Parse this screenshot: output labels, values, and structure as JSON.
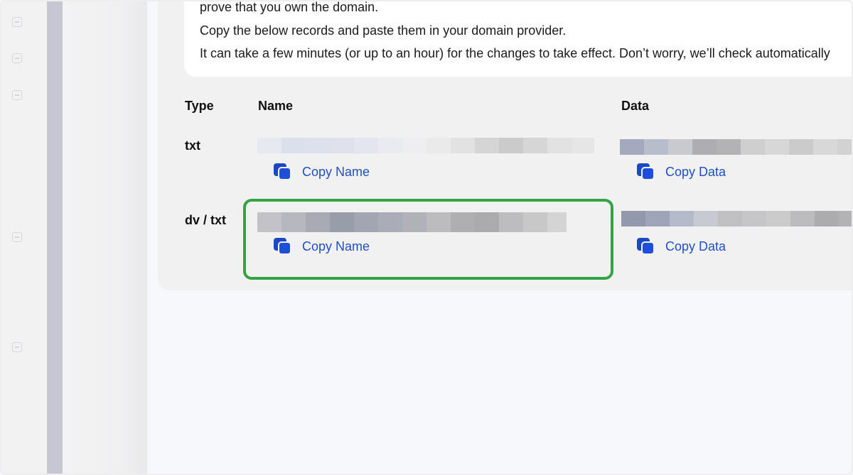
{
  "info": {
    "line1": "prove that you own the domain.",
    "line2": "Copy the below records and paste them in your domain provider.",
    "line3": "It can take a few minutes (or up to an hour) for the changes to take effect. Don’t worry, we’ll check automatically"
  },
  "table": {
    "headers": {
      "type": "Type",
      "name": "Name",
      "data": "Data"
    },
    "rows": [
      {
        "type": "txt",
        "copy_name_label": "Copy Name",
        "copy_data_label": "Copy Data"
      },
      {
        "type": "dv / txt",
        "copy_name_label": "Copy Name",
        "copy_data_label": "Copy Data"
      }
    ]
  },
  "icons": {
    "copy": "copy-icon",
    "rail": "arrow-square-icon"
  },
  "colors": {
    "link": "#1f4fc8",
    "highlight": "#34a343",
    "rail_strip": "#c6c7d3"
  }
}
